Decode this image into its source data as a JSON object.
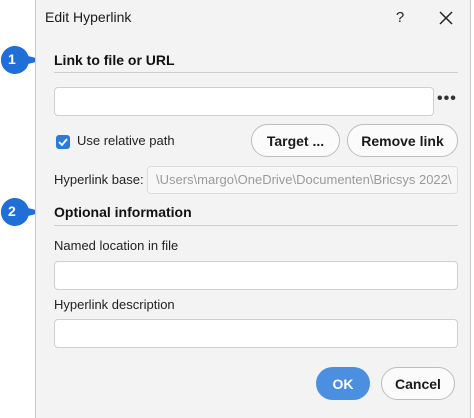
{
  "dialog": {
    "title": "Edit Hyperlink",
    "help_label": "?",
    "section1_title": "Link to file or URL",
    "url_value": "",
    "browse_label": "•••",
    "use_relative_path_label": "Use relative path",
    "use_relative_path_checked": true,
    "target_label": "Target ...",
    "remove_link_label": "Remove link",
    "hyperlink_base_label": "Hyperlink base:",
    "hyperlink_base_value": "\\Users\\margo\\OneDrive\\Documenten\\Bricsys 2022\\",
    "section2_title": "Optional information",
    "named_location_label": "Named location in file",
    "named_location_value": "",
    "description_label": "Hyperlink description",
    "description_value": "",
    "ok_label": "OK",
    "cancel_label": "Cancel"
  },
  "callouts": [
    {
      "number": "1"
    },
    {
      "number": "2"
    }
  ],
  "colors": {
    "accent": "#2b7bd8",
    "callout": "#1f6fd6",
    "ok_button": "#4a8fe0"
  }
}
